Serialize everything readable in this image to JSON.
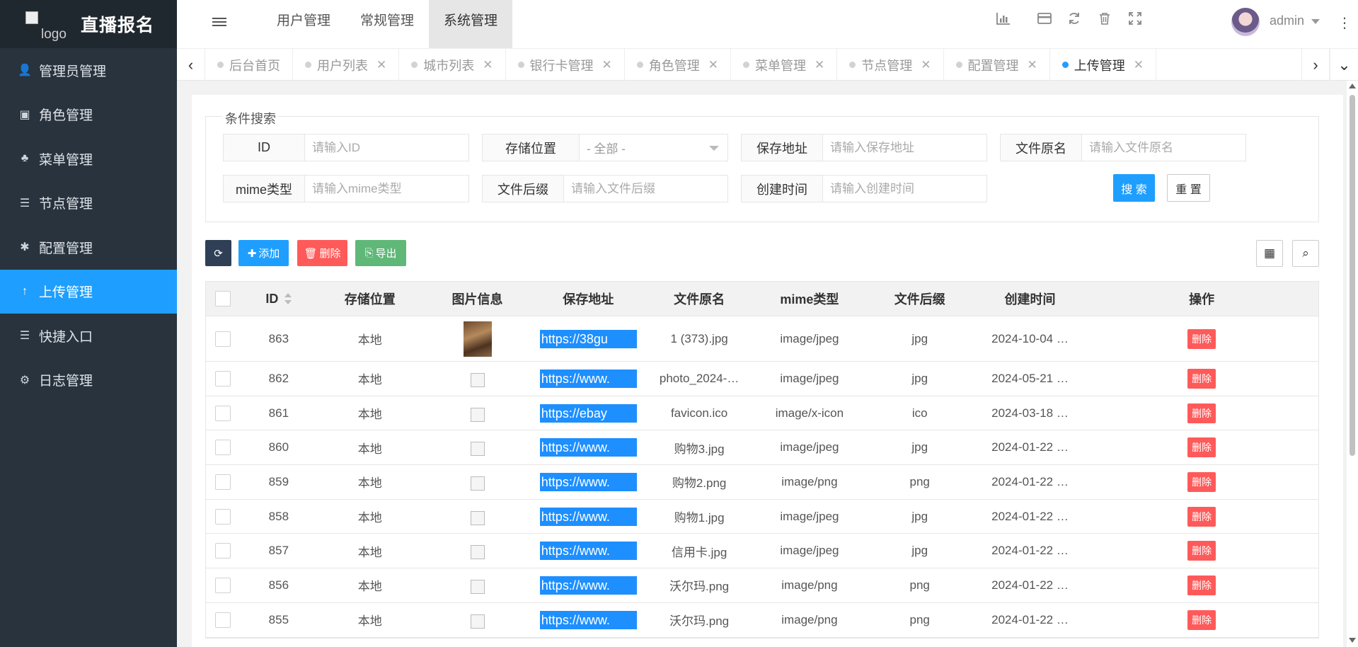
{
  "app": {
    "title": "直播报名",
    "logo_alt": "logo"
  },
  "sidebar": {
    "items": [
      {
        "label": "管理员管理",
        "icon": "user-icon",
        "glyph": "👤"
      },
      {
        "label": "角色管理",
        "icon": "id-card-icon",
        "glyph": "▣"
      },
      {
        "label": "菜单管理",
        "icon": "tree-icon",
        "glyph": "♣"
      },
      {
        "label": "节点管理",
        "icon": "list-icon",
        "glyph": "☰"
      },
      {
        "label": "配置管理",
        "icon": "asterisk-icon",
        "glyph": "✱"
      },
      {
        "label": "上传管理",
        "icon": "arrow-up-icon",
        "glyph": "↑",
        "active": true
      },
      {
        "label": "快捷入口",
        "icon": "list-icon",
        "glyph": "☰"
      },
      {
        "label": "日志管理",
        "icon": "gear-icon",
        "glyph": "⚙"
      }
    ]
  },
  "header": {
    "menu": [
      "用户管理",
      "常规管理",
      "系统管理"
    ],
    "user": "admin"
  },
  "tabs": [
    {
      "label": "后台首页",
      "closable": false
    },
    {
      "label": "用户列表",
      "closable": true
    },
    {
      "label": "城市列表",
      "closable": true
    },
    {
      "label": "银行卡管理",
      "closable": true
    },
    {
      "label": "角色管理",
      "closable": true
    },
    {
      "label": "菜单管理",
      "closable": true
    },
    {
      "label": "节点管理",
      "closable": true
    },
    {
      "label": "配置管理",
      "closable": true
    },
    {
      "label": "上传管理",
      "closable": true,
      "active": true
    }
  ],
  "search": {
    "legend": "条件搜索",
    "id_label": "ID",
    "id_placeholder": "请输入ID",
    "storage_label": "存储位置",
    "storage_value": "- 全部 -",
    "url_label": "保存地址",
    "url_placeholder": "请输入保存地址",
    "origname_label": "文件原名",
    "origname_placeholder": "请输入文件原名",
    "mime_label": "mime类型",
    "mime_placeholder": "请输入mime类型",
    "ext_label": "文件后缀",
    "ext_placeholder": "请输入文件后缀",
    "ctime_label": "创建时间",
    "ctime_placeholder": "请输入创建时间",
    "search_btn": "搜 索",
    "reset_btn": "重 置"
  },
  "toolbar": {
    "add": "添加",
    "delete": "删除",
    "export": "导出"
  },
  "table": {
    "headers": [
      "ID",
      "存储位置",
      "图片信息",
      "保存地址",
      "文件原名",
      "mime类型",
      "文件后缀",
      "创建时间",
      "操作"
    ],
    "delete_label": "删除",
    "rows": [
      {
        "id": "863",
        "storage": "本地",
        "url": "https://38gu",
        "name": "1 (373).jpg",
        "mime": "image/jpeg",
        "ext": "jpg",
        "time": "2024-10-04 …",
        "thumb": true
      },
      {
        "id": "862",
        "storage": "本地",
        "url": "https://www.",
        "name": "photo_2024-…",
        "mime": "image/jpeg",
        "ext": "jpg",
        "time": "2024-05-21 …"
      },
      {
        "id": "861",
        "storage": "本地",
        "url": "https://ebay",
        "name": "favicon.ico",
        "mime": "image/x-icon",
        "ext": "ico",
        "time": "2024-03-18 …"
      },
      {
        "id": "860",
        "storage": "本地",
        "url": "https://www.",
        "name": "购物3.jpg",
        "mime": "image/jpeg",
        "ext": "jpg",
        "time": "2024-01-22 …"
      },
      {
        "id": "859",
        "storage": "本地",
        "url": "https://www.",
        "name": "购物2.png",
        "mime": "image/png",
        "ext": "png",
        "time": "2024-01-22 …"
      },
      {
        "id": "858",
        "storage": "本地",
        "url": "https://www.",
        "name": "购物1.jpg",
        "mime": "image/jpeg",
        "ext": "jpg",
        "time": "2024-01-22 …"
      },
      {
        "id": "857",
        "storage": "本地",
        "url": "https://www.",
        "name": "信用卡.jpg",
        "mime": "image/jpeg",
        "ext": "jpg",
        "time": "2024-01-22 …"
      },
      {
        "id": "856",
        "storage": "本地",
        "url": "https://www.",
        "name": "沃尔玛.png",
        "mime": "image/png",
        "ext": "png",
        "time": "2024-01-22 …"
      },
      {
        "id": "855",
        "storage": "本地",
        "url": "https://www.",
        "name": "沃尔玛.png",
        "mime": "image/png",
        "ext": "png",
        "time": "2024-01-22 …"
      }
    ]
  },
  "colors": {
    "primary": "#1e9fff",
    "sidebar": "#28333e",
    "danger": "#ff5a5a",
    "success": "#5fb878",
    "dark": "#2f4056"
  }
}
